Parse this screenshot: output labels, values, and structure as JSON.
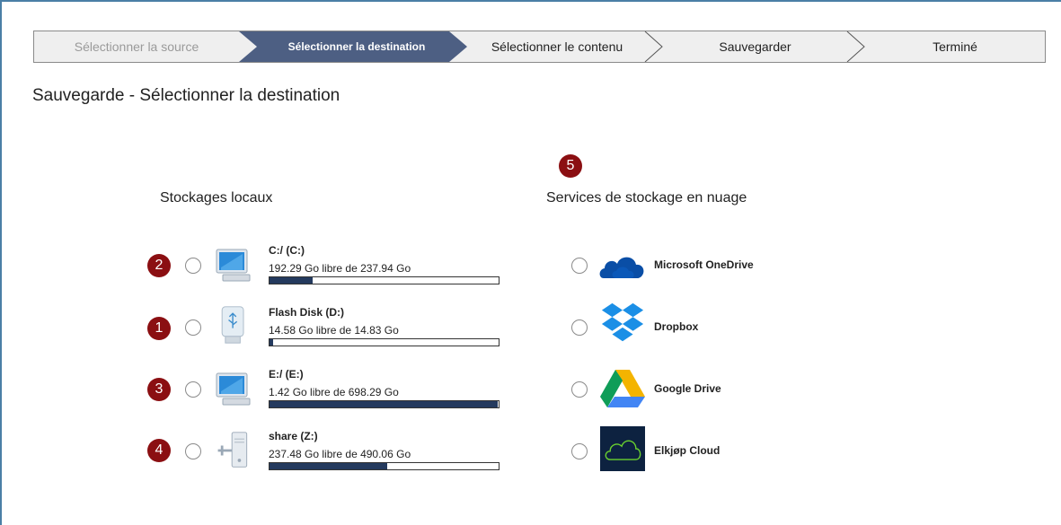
{
  "wizard": {
    "steps": [
      {
        "label": "Sélectionner la source",
        "state": "done"
      },
      {
        "label": "Sélectionner la destination",
        "state": "active"
      },
      {
        "label": "Sélectionner le contenu",
        "state": "pending"
      },
      {
        "label": "Sauvegarder",
        "state": "pending"
      },
      {
        "label": "Terminé",
        "state": "pending"
      }
    ],
    "active_color": "#4d5f83"
  },
  "page": {
    "title": "Sauvegarde - Sélectionner la destination"
  },
  "local": {
    "title": "Stockages locaux",
    "drives": [
      {
        "badge": "2",
        "icon": "computer-drive-icon",
        "name": "C:/ (C:)",
        "free_text": "192.29 Go libre de 237.94 Go",
        "used_fraction": 0.19
      },
      {
        "badge": "1",
        "icon": "usb-flash-drive-icon",
        "name": "Flash Disk (D:)",
        "free_text": "14.58 Go libre de 14.83 Go",
        "used_fraction": 0.017
      },
      {
        "badge": "3",
        "icon": "computer-drive-icon",
        "name": "E:/ (E:)",
        "free_text": "1.42 Go libre de 698.29 Go",
        "used_fraction": 0.998
      },
      {
        "badge": "4",
        "icon": "network-share-icon",
        "name": "share (Z:)",
        "free_text": "237.48 Go libre de 490.06 Go",
        "used_fraction": 0.515
      }
    ]
  },
  "cloud": {
    "badge": "5",
    "title": "Services de stockage en nuage",
    "services": [
      {
        "icon": "onedrive-icon",
        "name": "Microsoft OneDrive",
        "color": "#0a4ea6"
      },
      {
        "icon": "dropbox-icon",
        "name": "Dropbox",
        "color": "#1b8fe6"
      },
      {
        "icon": "google-drive-icon",
        "name": "Google Drive",
        "color": "#f4b400"
      },
      {
        "icon": "elkjop-cloud-icon",
        "name": "Elkjøp Cloud",
        "color": "#0d2240"
      }
    ]
  },
  "colors": {
    "badge": "#8b0f12",
    "usage_fill": "#243a5e"
  }
}
